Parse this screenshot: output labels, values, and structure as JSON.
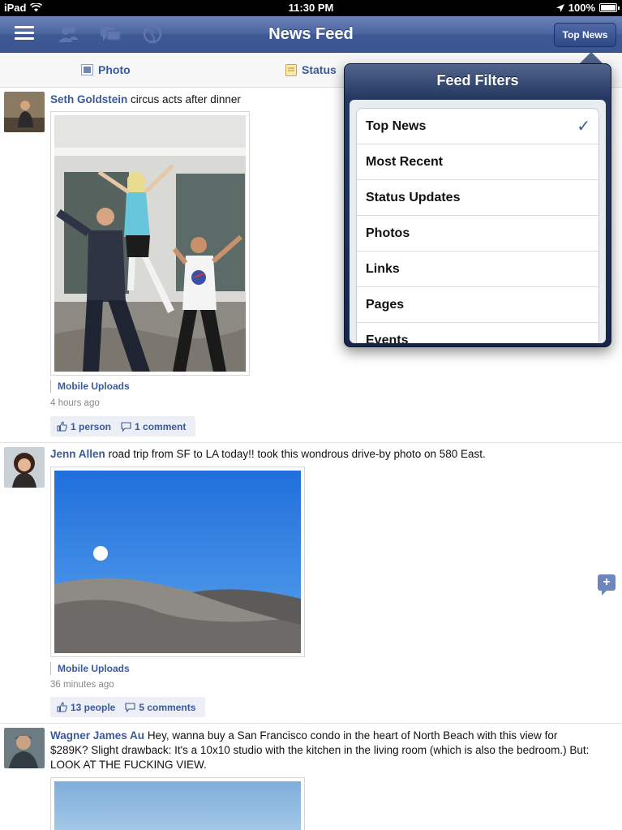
{
  "status_bar": {
    "device": "iPad",
    "time": "11:30 PM",
    "battery": "100%"
  },
  "navbar": {
    "title": "News Feed",
    "filter_button": "Top News"
  },
  "composer": [
    {
      "label": "Photo",
      "icon": "camera-icon"
    },
    {
      "label": "Status",
      "icon": "status-note-icon"
    }
  ],
  "feed_filters": {
    "title": "Feed Filters",
    "items": [
      {
        "label": "Top News",
        "selected": true
      },
      {
        "label": "Most Recent",
        "selected": false
      },
      {
        "label": "Status Updates",
        "selected": false
      },
      {
        "label": "Photos",
        "selected": false
      },
      {
        "label": "Links",
        "selected": false
      },
      {
        "label": "Pages",
        "selected": false
      },
      {
        "label": "Events",
        "selected": false
      }
    ]
  },
  "posts": [
    {
      "author": "Seth Goldstein",
      "text": "circus acts after dinner",
      "album": "Mobile Uploads",
      "time": "4 hours ago",
      "likes": "1 person",
      "comments": "1 comment"
    },
    {
      "author": "Jenn Allen",
      "text": "road trip from SF to LA today!! took this wondrous drive-by photo on 580 East.",
      "album": "Mobile Uploads",
      "time": "36 minutes ago",
      "likes": "13 people",
      "comments": "5 comments"
    },
    {
      "author": "Wagner James Au",
      "text": "Hey, wanna buy a San Francisco condo in the heart of North Beach with this view for $289K? Slight drawback: It's a 10x10 studio with the kitchen in the living room (which is also the bedroom.) But: LOOK AT THE FUCKING VIEW."
    }
  ],
  "colors": {
    "brand": "#3b5998",
    "navbar": "#4a64a0",
    "popover": "#1b2d55"
  }
}
